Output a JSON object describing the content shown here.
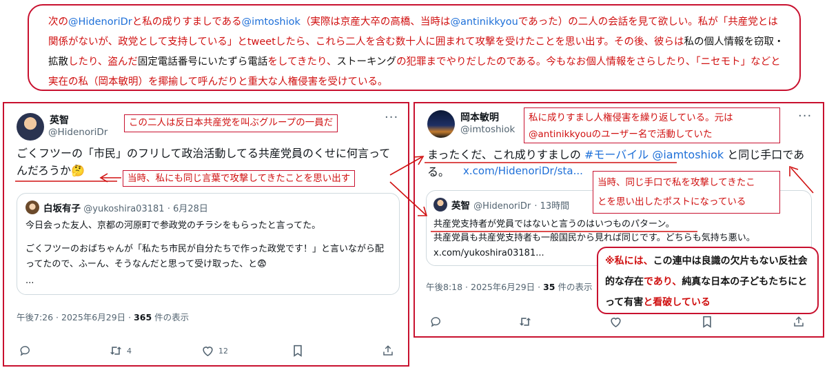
{
  "top_note": {
    "segments": [
      {
        "t": "次の",
        "c": "red"
      },
      {
        "t": "@HidenoriDr",
        "c": "blue"
      },
      {
        "t": "と私の成りすましである",
        "c": "red"
      },
      {
        "t": "@imtoshiok",
        "c": "blue"
      },
      {
        "t": "（実際は京産大卒の高橋、当時は",
        "c": "red"
      },
      {
        "t": "@antinikkyou",
        "c": "blue"
      },
      {
        "t": "であった）の二人の会話を見て欲しい。私が「共産党とは関係がないが、政党として支持している」とtweetしたら、これら二人を含む数十人に囲まれて攻撃を受けたことを思い出す。その後、彼らは",
        "c": "red"
      },
      {
        "t": "私の個人情報を窃取・拡散",
        "c": "blk"
      },
      {
        "t": "したり、盗んだ",
        "c": "red"
      },
      {
        "t": "固定電話番号にいたずら電話",
        "c": "blk"
      },
      {
        "t": "をしてきたり、",
        "c": "red"
      },
      {
        "t": "ストーキング",
        "c": "blk"
      },
      {
        "t": "の犯罪までやりだしたのである。今もなお個人情報をさらしたり、「ニセモト」などと実在の私（岡本敏明）を揶揄して呼んだりと重大な人権侵害を受けている。",
        "c": "red"
      }
    ]
  },
  "left_tweet": {
    "name": "英智",
    "handle": "@HidenoriDr",
    "annotation": "この二人は反日本共産党を叫ぶグループの一員だ",
    "text": "ごくフツーの「市民」のフリして政治活動してる共産党員のくせに何言ってんだろうか🤔",
    "annotation2": "当時、私にも同じ言葉で攻撃してきたことを思い出す",
    "quote": {
      "name": "白坂有子",
      "handle": "@yukoshira03181",
      "date": "· 6月28日",
      "line1": "今日会った友人、京都の河原町で参政党のチラシをもらったと言ってた。",
      "line2": "ごくフツーのおばちゃんが「私たち市民が自分たちで作った政党です！」と言いながら配ってたので、ふーん、そうなんだと思って受け取った、と😨",
      "line3": "..."
    },
    "meta": "午後7:26 · 2025年6月29日 · ",
    "views": "365",
    "views_label": " 件の表示",
    "retweets": "4",
    "likes": "12"
  },
  "right_tweet": {
    "name": "岡本敏明",
    "handle": "@imtoshiok",
    "annotation_line1": "私に成りすまし人権侵害を繰り返している。元は",
    "annotation_line2": "@antinikkyouのユーザー名で活動していた",
    "text_pre": "まったくだ、これ成りすましの ",
    "hashtag": "#モーバイル",
    "mention": "@iamtoshiok",
    "text_post": " と同じ手口である。",
    "link": "x.com/HidenoriDr/sta...",
    "annotation3_line1": "当時、同じ手口で私を攻撃してきたこ",
    "annotation3_line2": "とを思い出したポストになっている",
    "quote": {
      "name": "英智",
      "handle": "@HidenoriDr",
      "date": "· 13時間",
      "line1": "共産党支持者が党員ではないと言うのはいつものパターン。",
      "line2": "共産党員も共産党支持者も一般国民から見れば同じです。どちらも気持ち悪い。",
      "link": "x.com/yukoshira03181..."
    },
    "meta": "午後8:18 · 2025年6月29日 · ",
    "views": "35",
    "views_label": " 件の表示"
  },
  "note": {
    "segments": [
      {
        "t": "※私には、",
        "c": "red"
      },
      {
        "t": "この連中は良識の欠片もない反社会的な存在",
        "c": "blk"
      },
      {
        "t": "であり、",
        "c": "red"
      },
      {
        "t": "純真な日本の子どもたちにとって有害",
        "c": "blk"
      },
      {
        "t": "と看破している",
        "c": "red"
      }
    ]
  },
  "icons": [
    "reply-icon",
    "retweet-icon",
    "like-icon",
    "bookmark-icon",
    "share-icon",
    "more-icon",
    "thinking-face-emoji",
    "fearful-face-emoji"
  ],
  "colors": {
    "annotation_red": "#c8102e",
    "link_blue": "#1d6fd8",
    "text": "#0f1419",
    "muted": "#536471"
  }
}
